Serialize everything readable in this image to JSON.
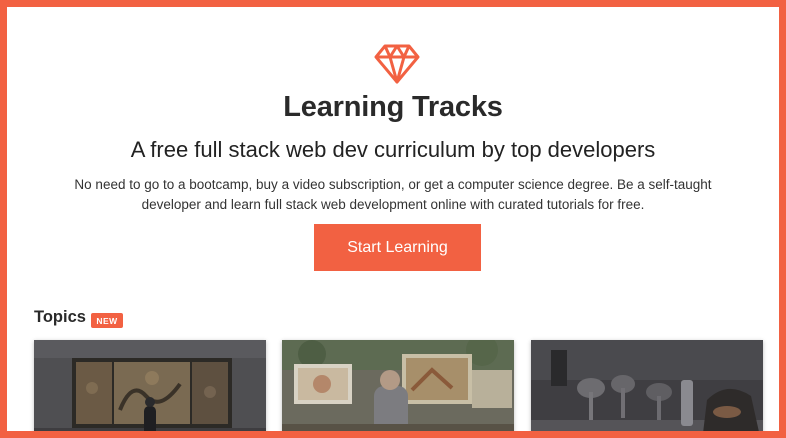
{
  "brand": {
    "logo_icon": "diamond-icon",
    "accent_color": "#f26142"
  },
  "hero": {
    "title": "Learning Tracks",
    "subtitle": "A free full stack web dev curriculum by top developers",
    "description_line1": "No need to go to a bootcamp, buy a video subscription, or get a computer science degree. Be a self-taught",
    "description_line2": "developer and learn full stack web development online with curated tutorials for free.",
    "cta_label": "Start Learning"
  },
  "topics": {
    "heading": "Topics",
    "badge": "NEW",
    "cards": [
      {
        "image": "museum-paintings-photo"
      },
      {
        "image": "street-artist-photo"
      },
      {
        "image": "restaurant-table-photo"
      }
    ]
  }
}
